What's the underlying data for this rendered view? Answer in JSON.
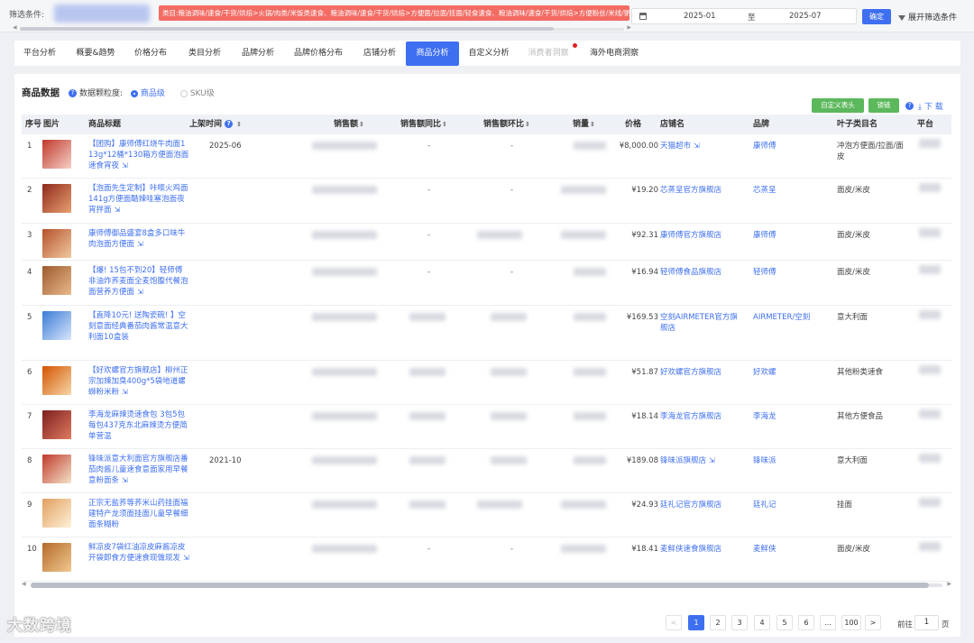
{
  "filter": {
    "label": "筛选条件:",
    "category_tags": "类目:粮油调味/速食/干货/烘焙>火锅/肉类/米饭类速食、粮油调味/速食/干货/烘焙>方便面/拉面/挂面/轻食速食、粮油调味/速食/干货/烘焙>方便粉丝/米线/粥汤/冲",
    "date_start": "2025-01",
    "date_to": "至",
    "date_end": "2025-07",
    "confirm": "确定",
    "expand": "展开筛选条件"
  },
  "tabs": [
    {
      "label": "平台分析"
    },
    {
      "label": "概要&趋势"
    },
    {
      "label": "价格分布"
    },
    {
      "label": "类目分析"
    },
    {
      "label": "品牌分析"
    },
    {
      "label": "品牌价格分布"
    },
    {
      "label": "店铺分析"
    },
    {
      "label": "商品分析"
    },
    {
      "label": "自定义分析"
    },
    {
      "label": "消费者洞察"
    },
    {
      "label": "海外电商洞察"
    }
  ],
  "panel": {
    "title": "商品数据",
    "granularity_label": "数据颗粒度:",
    "opt_product": "商品级",
    "opt_sku": "SKU级",
    "custom_header": "自定义表头",
    "lock": "锁链",
    "download": "下 载"
  },
  "columns": {
    "idx": "序号",
    "img": "图片",
    "title": "商品标题",
    "listed": "上架时间",
    "sales": "销售额",
    "yoy": "销售额同比",
    "mom": "销售额环比",
    "volume": "销量",
    "price": "价格",
    "shop": "店铺名",
    "brand": "品牌",
    "leaf": "叶子类目名",
    "platform": "平台"
  },
  "rows": [
    {
      "idx": "1",
      "title": "【团购】康师傅红烧牛肉面113g*12桶*130箱方便面泡面速食宵夜",
      "listed": "2025-06",
      "yoy": "-",
      "mom": "-",
      "price": "¥8,000.00",
      "shop": "天猫超市",
      "brand": "康师傅",
      "leaf": "冲泡方便面/拉面/面皮",
      "img_color": "#c0392b"
    },
    {
      "idx": "2",
      "title": "【泡面先生定制】咔嚓火鸡面141g方便面酷辣哇塞泡面夜宵拌面",
      "listed": "",
      "yoy": "-",
      "mom": "-",
      "price": "¥19.20",
      "shop": "芯蒸呈官方旗舰店",
      "brand": "芯蒸呈",
      "leaf": "面皮/米皮",
      "img_color": "#8e2a1c"
    },
    {
      "idx": "3",
      "title": "康师傅御品盛宴8盒多口味牛肉泡面方便面",
      "listed": "",
      "yoy": "-",
      "mom": "",
      "price": "¥92.31",
      "shop": "康师傅官方旗舰店",
      "brand": "康师傅",
      "leaf": "面皮/米皮",
      "img_color": "#b5522b"
    },
    {
      "idx": "4",
      "title": "【爆! 15包不到20】轻师傅非油炸荞麦面全麦饱腹代餐泡面营养方便面",
      "listed": "",
      "yoy": "-",
      "mom": "-",
      "price": "¥16.94",
      "shop": "轻师傅食品旗舰店",
      "brand": "轻师傅",
      "leaf": "面皮/米皮",
      "img_color": "#9c5a2e"
    },
    {
      "idx": "5",
      "title": "【直降10元! 送陶瓷碗! 】空刻意面经典番茄肉酱常温意大利面10盒装",
      "listed": "",
      "yoy": "",
      "mom": "",
      "price": "¥169.53",
      "shop": "空刻AIRMETER官方旗舰店",
      "brand": "AIRMETER/空刻",
      "leaf": "意大利面",
      "img_color": "#3a7bd5"
    },
    {
      "idx": "6",
      "title": "【好欢螺官方旗舰店】柳州正宗加辣加臭400g*5袋地道螺蛳粉米粉",
      "listed": "",
      "yoy": "",
      "mom": "",
      "price": "¥51.87",
      "shop": "好欢螺官方旗舰店",
      "brand": "好欢螺",
      "leaf": "其他粉类速食",
      "img_color": "#d35400"
    },
    {
      "idx": "7",
      "title": "李海龙麻辣烫速食包 3包5包 每包437克东北麻辣烫方便简单营温",
      "listed": "",
      "yoy": "",
      "mom": "",
      "price": "¥18.14",
      "shop": "李海龙官方旗舰店",
      "brand": "李海龙",
      "leaf": "其他方便食品",
      "img_color": "#7b1f1f"
    },
    {
      "idx": "8",
      "title": "锋味派意大利面官方旗舰店番茄肉酱儿童速食意面家用早餐意粉面条",
      "listed": "2021-10",
      "yoy": "",
      "mom": "",
      "price": "¥189.08",
      "shop": "锋味派旗舰店",
      "brand": "锋味派",
      "leaf": "意大利面",
      "img_color": "#c0392b"
    },
    {
      "idx": "9",
      "title": "正宗无盐荞等荞米山药挂面福建特产龙须面挂面儿童早餐细面条糊粉",
      "listed": "",
      "yoy": "",
      "mom": "",
      "price": "¥24.93",
      "shop": "廷礼记官方旗舰店",
      "brand": "廷礼记",
      "leaf": "挂面",
      "img_color": "#e0a060"
    },
    {
      "idx": "10",
      "title": "鲜凉皮7袋红油凉皮麻酱凉皮开袋即食方便速食现做现发",
      "listed": "",
      "yoy": "-",
      "mom": "-",
      "price": "¥18.41",
      "shop": "麦鲜侠速食旗舰店",
      "brand": "麦鲜侠",
      "leaf": "面皮/米皮",
      "img_color": "#b56a2a"
    }
  ],
  "pagination": {
    "prev": "<",
    "pages": [
      "1",
      "2",
      "3",
      "4",
      "5",
      "6",
      "...",
      "100"
    ],
    "next": ">",
    "goto_prefix": "前往",
    "goto_value": "1",
    "goto_suffix": "页"
  },
  "watermark": "大数跨境",
  "colors": {
    "accent": "#3e6ff0",
    "tag_red": "#f36b63",
    "green": "#5cb85c"
  }
}
